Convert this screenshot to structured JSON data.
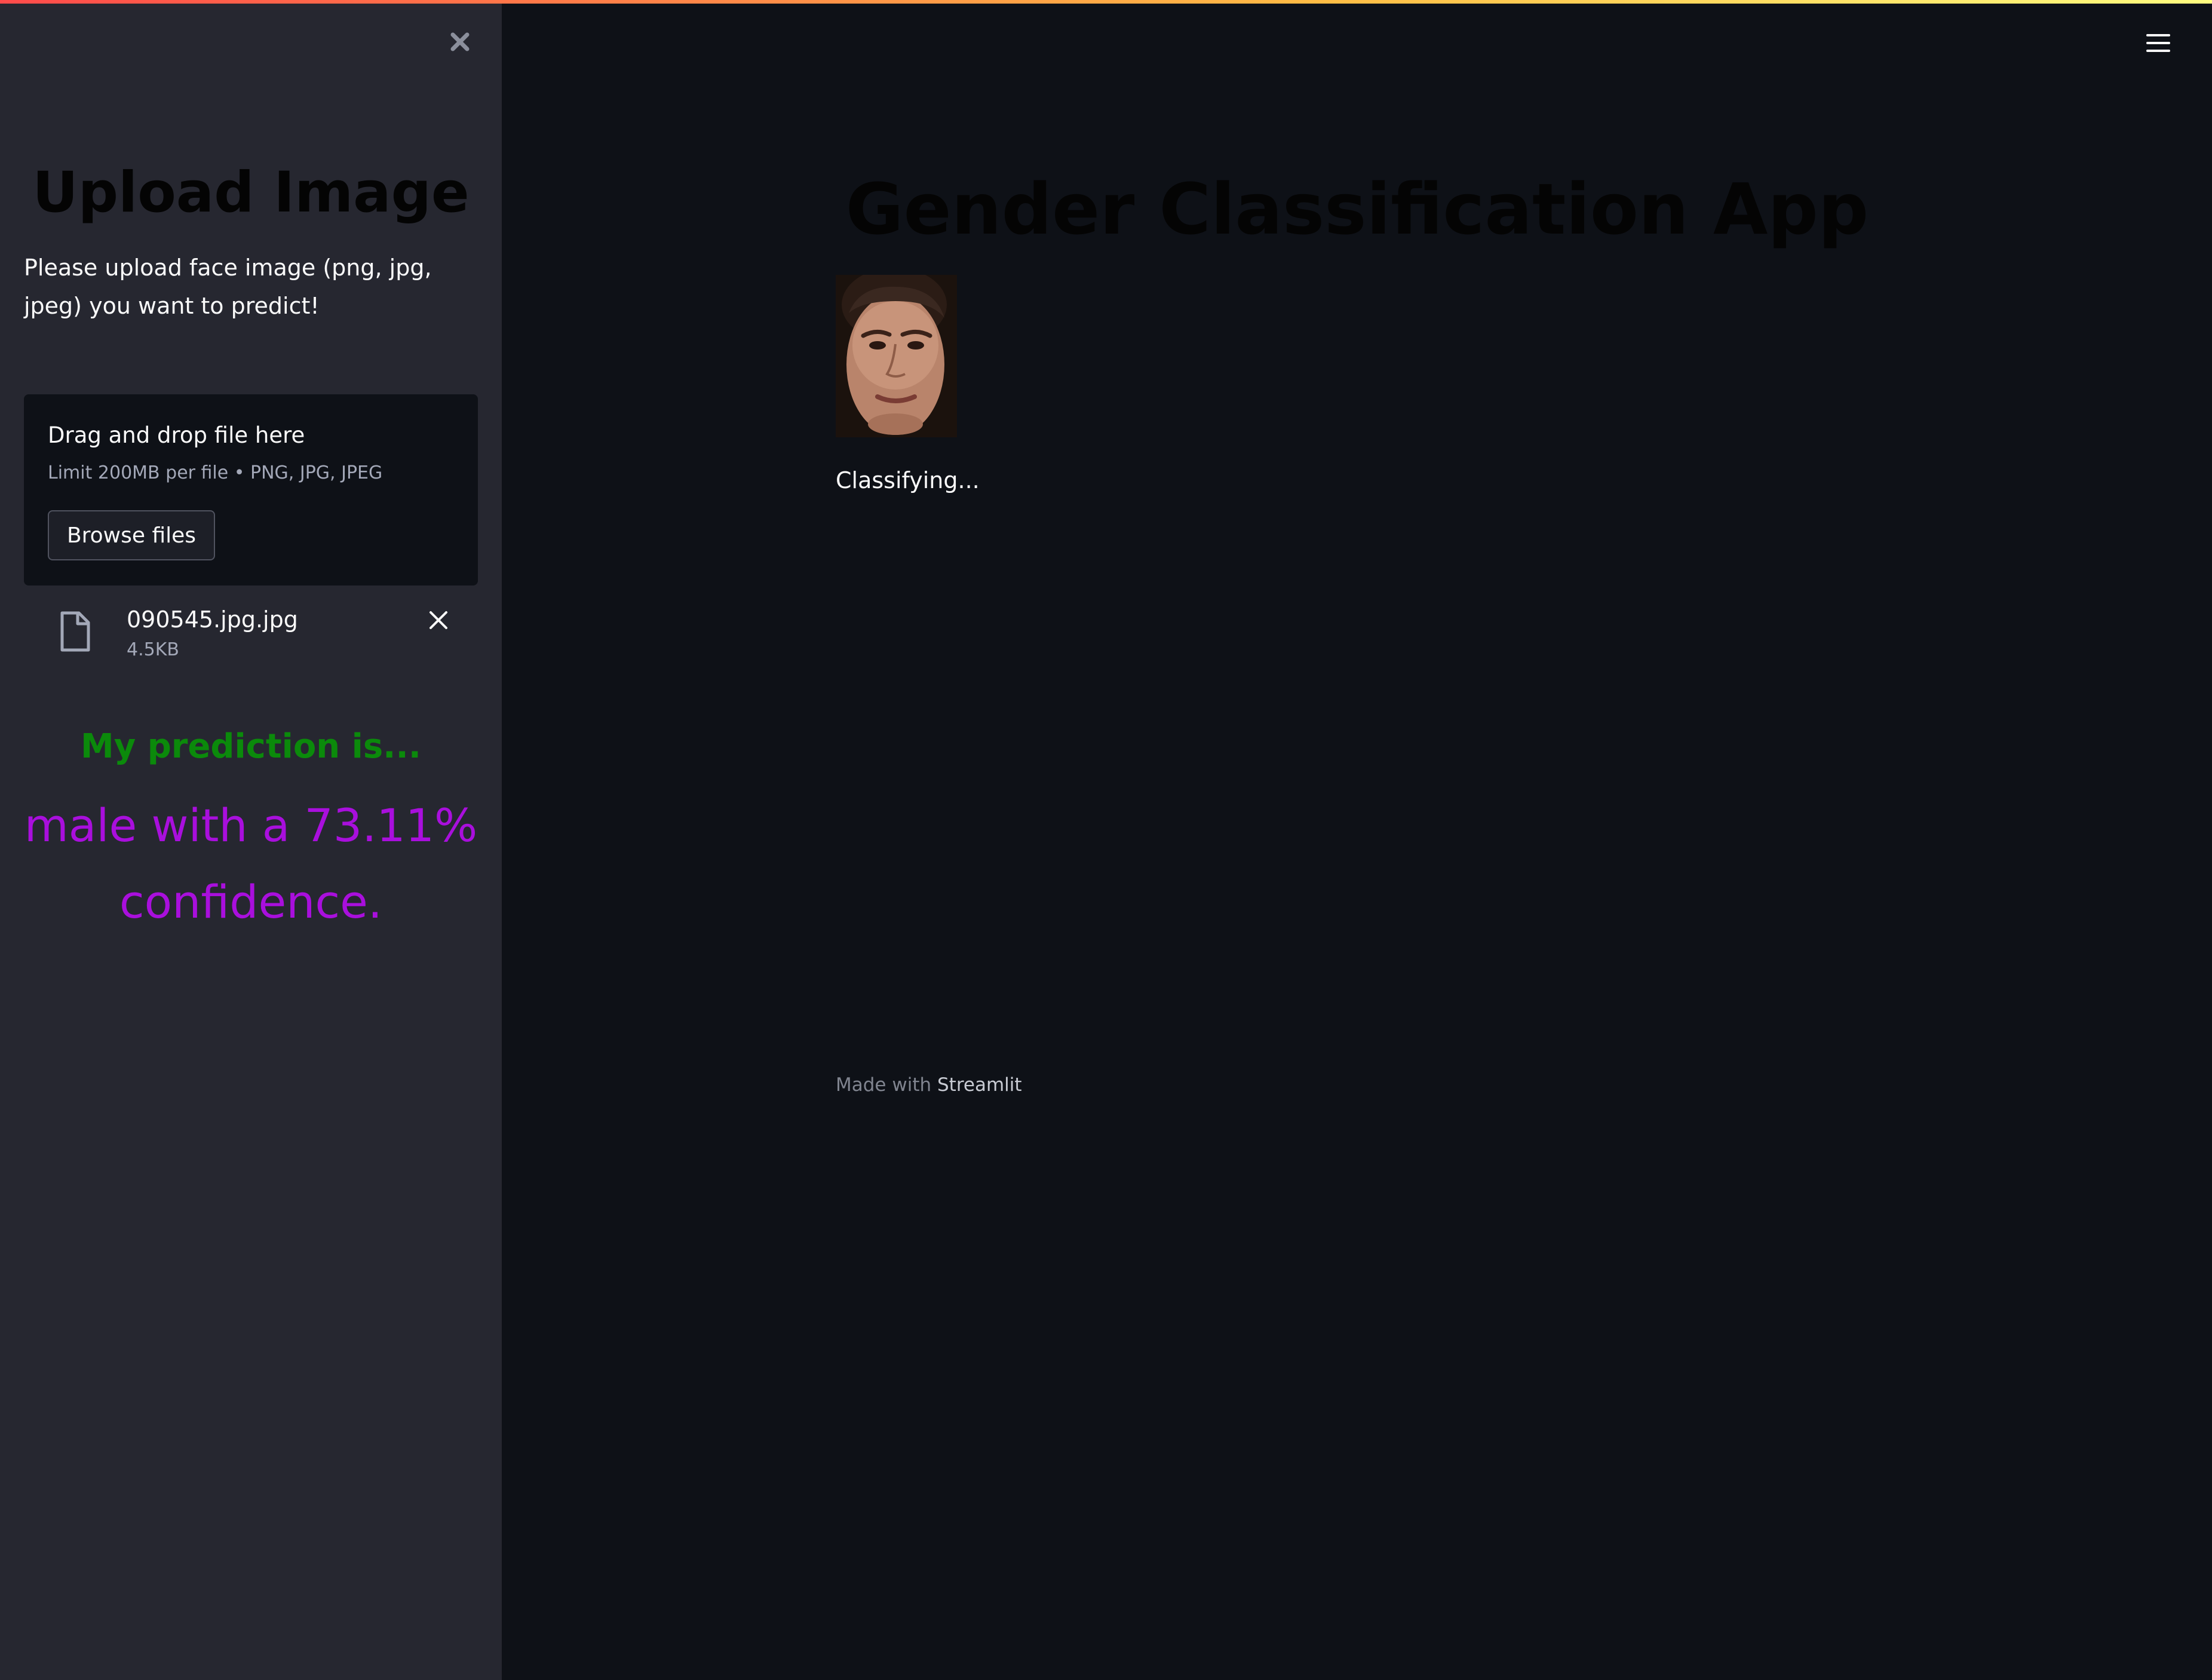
{
  "sidebar": {
    "title": "Upload Image",
    "description": "Please upload face image (png, jpg, jpeg) you want to predict!",
    "uploader": {
      "title": "Drag and drop file here",
      "limit": "Limit 200MB per file • PNG, JPG, JPEG",
      "browse_label": "Browse files"
    },
    "file": {
      "name": "090545.jpg.jpg",
      "size": "4.5KB"
    },
    "prediction": {
      "heading": "My prediction is...",
      "result": "male with a 73.11% confidence."
    }
  },
  "main": {
    "title": "Gender Classification App",
    "status": "Classifying...",
    "footer": {
      "prefix": "Made with",
      "link": "Streamlit"
    }
  },
  "colors": {
    "sidebar_bg": "#262730",
    "main_bg": "#0e1117",
    "prediction_heading": "#0b8a0b",
    "prediction_result": "#a90fdd"
  },
  "icons": {
    "sidebar_close": "close-icon",
    "menu": "hamburger-menu-icon",
    "file": "file-icon",
    "file_remove": "close-icon"
  }
}
